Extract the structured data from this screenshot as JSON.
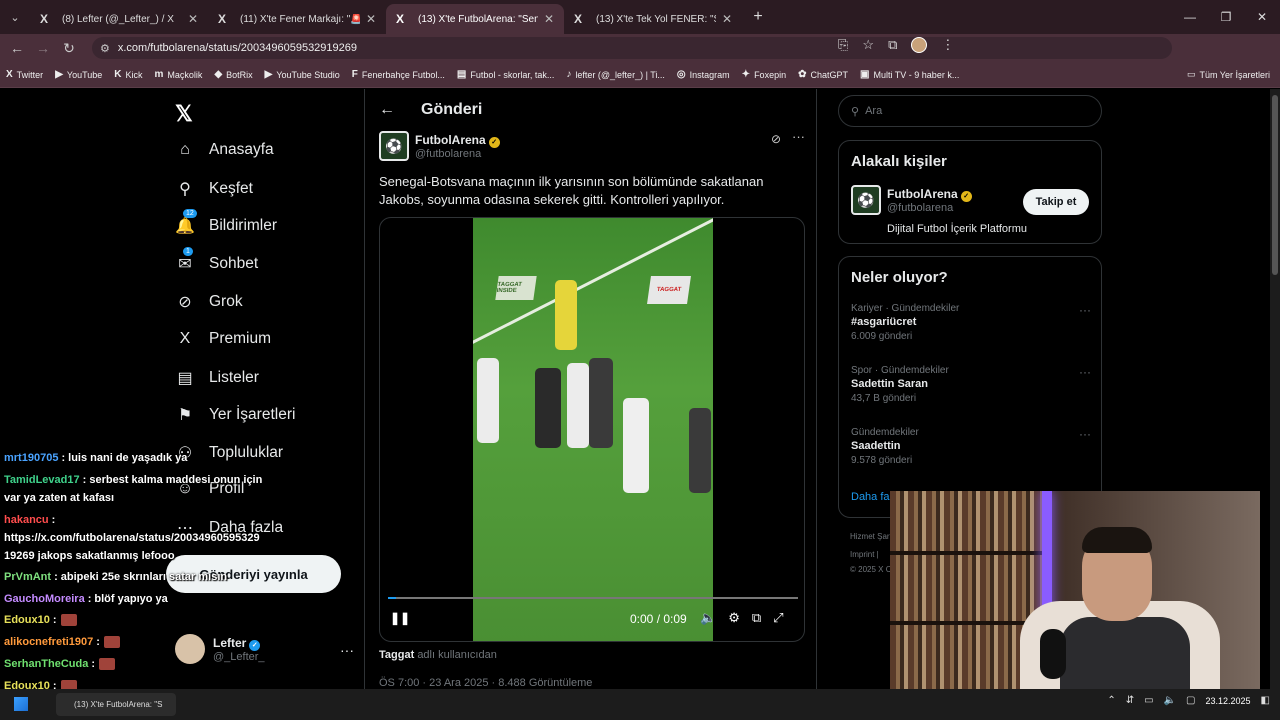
{
  "browser": {
    "tabs": [
      {
        "icon": "X",
        "title": "(8) Lefter (@_Lefter_) / X"
      },
      {
        "icon": "X",
        "title": "(11) X'te Fener Markajı: \"🚨 Fener"
      },
      {
        "icon": "X",
        "title": "(13) X'te FutbolArena: \"Senegal"
      },
      {
        "icon": "X",
        "title": "(13) X'te Tek Yol FENER: \"Samsun"
      }
    ],
    "url": "x.com/futbolarena/status/2003496059532919269",
    "bookmarks": [
      {
        "icon": "X",
        "label": "Twitter"
      },
      {
        "icon": "▶",
        "label": "YouTube"
      },
      {
        "icon": "K",
        "label": "Kick"
      },
      {
        "icon": "m",
        "label": "Maçkolik"
      },
      {
        "icon": "◆",
        "label": "BotRix"
      },
      {
        "icon": "▶",
        "label": "YouTube Studio"
      },
      {
        "icon": "F",
        "label": "Fenerbahçe Futbol..."
      },
      {
        "icon": "▤",
        "label": "Futbol - skorlar, tak..."
      },
      {
        "icon": "♪",
        "label": "lefter (@_lefter_) | Ti..."
      },
      {
        "icon": "◎",
        "label": "Instagram"
      },
      {
        "icon": "✦",
        "label": "Foxepin"
      },
      {
        "icon": "✿",
        "label": "ChatGPT"
      },
      {
        "icon": "▣",
        "label": "Multi TV - 9 haber k..."
      }
    ],
    "all_bookmarks": "Tüm Yer İşaretleri"
  },
  "nav": {
    "items": [
      {
        "icon": "⌂",
        "label": "Anasayfa"
      },
      {
        "icon": "⚲",
        "label": "Keşfet"
      },
      {
        "icon": "🔔",
        "label": "Bildirimler",
        "badge": "12"
      },
      {
        "icon": "✉",
        "label": "Sohbet",
        "badge": "1"
      },
      {
        "icon": "⊘",
        "label": "Grok"
      },
      {
        "icon": "X",
        "label": "Premium"
      },
      {
        "icon": "▤",
        "label": "Listeler"
      },
      {
        "icon": "⚑",
        "label": "Yer İşaretleri"
      },
      {
        "icon": "⚇",
        "label": "Topluluklar"
      },
      {
        "icon": "☺",
        "label": "Profil"
      },
      {
        "icon": "⋯",
        "label": "Daha fazla"
      }
    ],
    "post_button": "Gönderiyi yayınla",
    "me": {
      "name": "Lefter",
      "handle": "@_Lefter_"
    }
  },
  "post": {
    "header": "Gönderi",
    "author": {
      "name": "FutbolArena",
      "handle": "@futbolarena"
    },
    "text": "Senegal-Botsvana maçının ilk yarısının son bölümünde sakatlanan Jakobs, soyunma odasına sekerek gitti. Kontrolleri yapılıyor.",
    "video": {
      "time": "0:00 / 0:09",
      "progress": 0.02,
      "board_left": "TAGGAT INSIDE",
      "board_right": "TAGGAT"
    },
    "source_user": "Taggat",
    "source_suffix": "adlı kullanıcıdan",
    "meta": "ÖS 7:00 · 23 Ara 2025 · 8.488 Görüntüleme"
  },
  "sidebar": {
    "search_placeholder": "Ara",
    "related_title": "Alakalı kişiler",
    "related": {
      "name": "FutbolArena",
      "handle": "@futbolarena",
      "desc": "Dijital Futbol İçerik Platformu",
      "follow": "Takip et"
    },
    "trends_title": "Neler oluyor?",
    "trends": [
      {
        "category": "Kariyer · Gündemdekiler",
        "title": "#asgariücret",
        "count": "6.009 gönderi"
      },
      {
        "category": "Spor · Gündemdekiler",
        "title": "Sadettin Saran",
        "count": "43,7 B gönderi"
      },
      {
        "category": "Gündemdekiler",
        "title": "Saadettin",
        "count": "9.578 gönderi"
      }
    ],
    "show_more": "Daha fazla",
    "footer": [
      "Hizmet Şartları",
      "Imprint |",
      "© 2025 X Corp."
    ]
  },
  "chat": [
    {
      "user": "mrt190705",
      "color": "#4aa3ff",
      "text": ": luis nani de yaşadık ya"
    },
    {
      "user": "TamidLevad17",
      "color": "#3fd28b",
      "text": ": serbest kalma maddesi onun için"
    },
    {
      "user": "",
      "color": "#fff",
      "text": "var ya zaten at kafası"
    },
    {
      "user": "hakancu",
      "color": "#ff4d4d",
      "text": ":"
    },
    {
      "user": "",
      "color": "#fff",
      "text": "https://x.com/futbolarena/status/20034960595329"
    },
    {
      "user": "",
      "color": "#fff",
      "text": "19269 jakops sakatlanmış lefooo"
    },
    {
      "user": "PrVmAnt",
      "color": "#7fe07f",
      "text": ": abipeki 25e skrınları satar mısın"
    },
    {
      "user": "GauchoMoreira",
      "color": "#c48bff",
      "text": ": blöf yapıyo ya"
    },
    {
      "user": "Edoux10",
      "color": "#e8e15a",
      "text": ":"
    },
    {
      "user": "alikocnefreti1907",
      "color": "#ff9a3c",
      "text": ":"
    },
    {
      "user": "SerhanTheCuda",
      "color": "#6fe06f",
      "text": ":"
    },
    {
      "user": "Edoux10",
      "color": "#e8e15a",
      "text": ":"
    }
  ],
  "taskbar": {
    "app": "(13) X'te FutbolArena: \"S",
    "date": "23.12.2025"
  }
}
